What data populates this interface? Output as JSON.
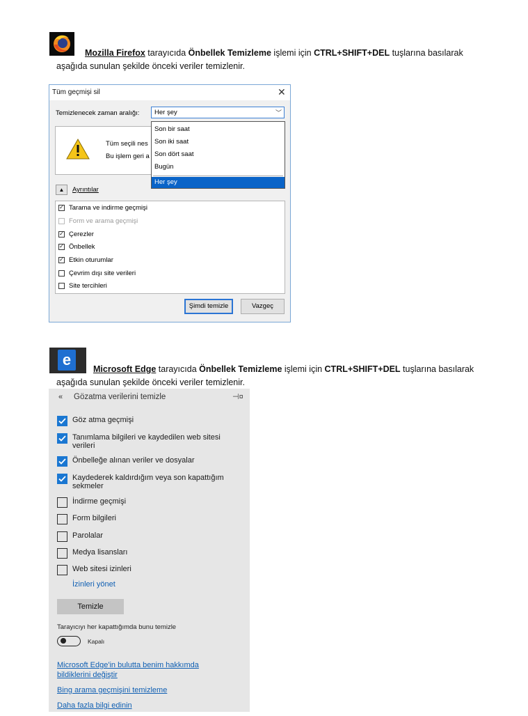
{
  "firefox_section": {
    "link_text": "Mozilla Firefox",
    "text_after_link": " tarayıcıda ",
    "bold_term": "Önbellek Temizleme",
    "text_mid": " işlemi için ",
    "shortcut": "CTRL+SHIFT+DEL",
    "text_end": " tuşlarına basılarak",
    "line2": "aşağıda sunulan şekilde önceki veriler temizlenir."
  },
  "firefox_dialog": {
    "title": "Tüm geçmişi sil",
    "close_glyph": "✕",
    "range_label": "Temizlenecek zaman aralığı:",
    "range_value": "Her şey",
    "warning_line1": "Tüm seçili nes",
    "warning_line2": "Bu işlem geri a",
    "dropdown_options": [
      "Son bir saat",
      "Son iki saat",
      "Son dört saat",
      "Bugün"
    ],
    "dropdown_selected": "Her şey",
    "details_label": "Ayrıntılar",
    "items": [
      {
        "label": "Tarama ve indirme geçmişi",
        "checked": true,
        "disabled": false
      },
      {
        "label": "Form ve arama geçmişi",
        "checked": false,
        "disabled": true
      },
      {
        "label": "Çerezler",
        "checked": true,
        "disabled": false
      },
      {
        "label": "Önbellek",
        "checked": true,
        "disabled": false
      },
      {
        "label": "Etkin oturumlar",
        "checked": true,
        "disabled": false
      },
      {
        "label": "Çevrim dışı site verileri",
        "checked": false,
        "disabled": false
      },
      {
        "label": "Site tercihleri",
        "checked": false,
        "disabled": false
      }
    ],
    "clear_button": "Şimdi temizle",
    "cancel_button": "Vazgeç"
  },
  "edge_section": {
    "link_text": "Microsoft Edge",
    "text_after_link": " tarayıcıda ",
    "bold_term": "Önbellek Temizleme",
    "text_mid": " işlemi için ",
    "shortcut": "CTRL+SHIFT+DEL",
    "text_end": " tuşlarına basılarak",
    "line2": "aşağıda sunulan şekilde önceki veriler temizlenir."
  },
  "edge_panel": {
    "back_glyph": "«",
    "title": "Gözatma verilerini temizle",
    "pin_glyph": "⊣¤",
    "items": [
      {
        "label": "Göz atma geçmişi",
        "checked": true
      },
      {
        "label": "Tanımlama bilgileri ve kaydedilen web sitesi verileri",
        "checked": true
      },
      {
        "label": "Önbelleğe alınan veriler ve dosyalar",
        "checked": true
      },
      {
        "label": "Kaydederek kaldırdığım veya son kapattığım sekmeler",
        "checked": true
      },
      {
        "label": "İndirme geçmişi",
        "checked": false
      },
      {
        "label": "Form bilgileri",
        "checked": false
      },
      {
        "label": "Parolalar",
        "checked": false
      },
      {
        "label": "Medya lisansları",
        "checked": false
      },
      {
        "label": "Web sitesi izinleri",
        "checked": false
      }
    ],
    "manage_permissions": "İzinleri yönet",
    "clear_button": "Temizle",
    "on_close_text": "Tarayıcıyı her kapattığımda bunu temizle",
    "toggle_state": "Kapalı",
    "link_cloud_line1": "Microsoft Edge'in bulutta benim hakkımda",
    "link_cloud_line2": "bildiklerini değiştir",
    "link_bing": "Bing arama geçmişini temizleme",
    "link_more": "Daha fazla bilgi edinin"
  },
  "colors": {
    "firefox_selection": "#0a64c8",
    "edge_checkbox": "#1a77d2",
    "edge_link": "#0f5fb3"
  }
}
